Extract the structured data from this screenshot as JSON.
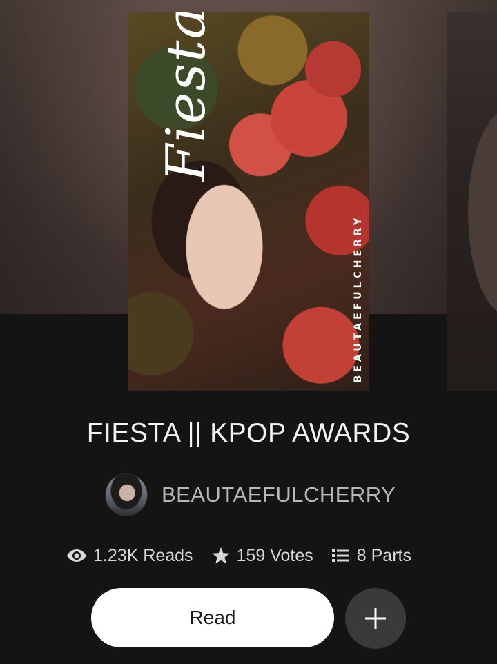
{
  "story": {
    "title": "FIESTA || KPOP AWARDS",
    "author": "BEAUTAEFULCHERRY"
  },
  "cover": {
    "script_text": "Fiesta",
    "author_text": "BEAUTAEFULCHERRY"
  },
  "stats": {
    "reads": "1.23K Reads",
    "votes": "159 Votes",
    "parts": "8 Parts"
  },
  "actions": {
    "read_label": "Read",
    "add_icon": "plus-icon"
  },
  "icons": {
    "reads": "eye-icon",
    "votes": "star-icon",
    "parts": "list-icon"
  },
  "colors": {
    "background": "#141414",
    "read_button": "#ffffff",
    "add_button": "#3a3a3a",
    "author_text": "#b8b8b8"
  }
}
